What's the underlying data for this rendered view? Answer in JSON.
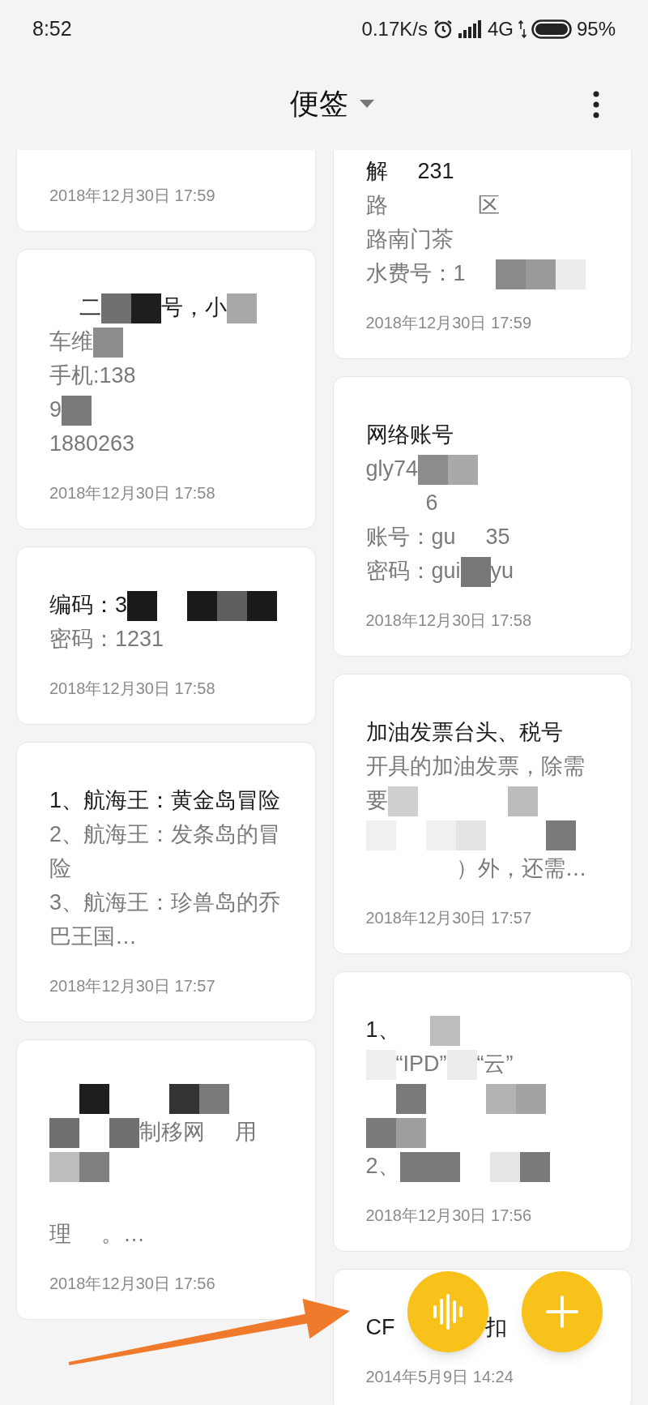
{
  "status_bar": {
    "time": "8:52",
    "speed": "0.17K/s",
    "network": "4G",
    "battery": "95%"
  },
  "header": {
    "title": "便签"
  },
  "columns": [
    {
      "notes": [
        {
          "lines": [
            [
              {
                "kind": "blank"
              }
            ]
          ],
          "date": "2018年12月30日 17:59"
        },
        {
          "lines": [
            [
              {
                "kind": "blank"
              },
              {
                "kind": "text",
                "text": "二"
              },
              {
                "kind": "pixel",
                "color": "#707070"
              },
              {
                "kind": "pixel",
                "color": "#1e1e1e"
              },
              {
                "kind": "text",
                "text": "号，小"
              },
              {
                "kind": "pixel",
                "color": "#a8a8a8"
              }
            ],
            [
              {
                "kind": "text",
                "text": "车维"
              },
              {
                "kind": "pixel",
                "color": "#8c8c8c"
              }
            ],
            [
              {
                "kind": "text",
                "text": "手机:138"
              }
            ],
            [
              {
                "kind": "text",
                "text": "9"
              },
              {
                "kind": "pixel",
                "color": "#7a7a7a"
              }
            ],
            [
              {
                "kind": "text",
                "text": "1880263"
              }
            ]
          ],
          "date": "2018年12月30日 17:58"
        },
        {
          "lines": [
            [
              {
                "kind": "text",
                "text": "编码：3"
              },
              {
                "kind": "pixel",
                "color": "#1a1a1a"
              },
              {
                "kind": "blank"
              },
              {
                "kind": "pixel",
                "color": "#1a1a1a"
              },
              {
                "kind": "pixel",
                "color": "#5e5e5e"
              },
              {
                "kind": "pixel",
                "color": "#1a1a1a"
              }
            ],
            [
              {
                "kind": "text",
                "text": "密码：1231"
              }
            ]
          ],
          "date": "2018年12月30日 17:58"
        },
        {
          "lines": [
            [
              {
                "kind": "text",
                "text": "1、航海王：黄金岛冒险"
              }
            ],
            [
              {
                "kind": "text",
                "text": "2、航海王：发条岛的冒险"
              }
            ],
            [
              {
                "kind": "text",
                "text": "3、航海王：珍兽岛的乔巴王国…"
              }
            ]
          ],
          "date": "2018年12月30日 17:57"
        },
        {
          "lines": [
            [
              {
                "kind": "blank"
              },
              {
                "kind": "pixel",
                "color": "#1e1e1e"
              },
              {
                "kind": "blank"
              },
              {
                "kind": "blank"
              },
              {
                "kind": "pixel",
                "color": "#333333"
              },
              {
                "kind": "pixel",
                "color": "#7a7a7a"
              }
            ],
            [
              {
                "kind": "pixel",
                "color": "#707070"
              },
              {
                "kind": "blank"
              },
              {
                "kind": "pixel",
                "color": "#707070"
              },
              {
                "kind": "text",
                "text": "制移网"
              },
              {
                "kind": "blank"
              },
              {
                "kind": "text",
                "text": "用"
              }
            ],
            [
              {
                "kind": "pixel",
                "color": "#bdbdbd"
              },
              {
                "kind": "pixel",
                "color": "#808080"
              }
            ],
            [
              {
                "kind": "blank"
              }
            ],
            [
              {
                "kind": "text",
                "text": "理"
              },
              {
                "kind": "blank"
              },
              {
                "kind": "text",
                "text": "。…"
              }
            ]
          ],
          "date": "2018年12月30日 17:56"
        }
      ]
    },
    {
      "notes": [
        {
          "lines": [
            [
              {
                "kind": "text",
                "text": "解"
              },
              {
                "kind": "blank"
              },
              {
                "kind": "text",
                "text": "231"
              }
            ],
            [
              {
                "kind": "text",
                "text": "路"
              },
              {
                "kind": "blank"
              },
              {
                "kind": "blank"
              },
              {
                "kind": "blank"
              },
              {
                "kind": "text",
                "text": "区"
              }
            ],
            [
              {
                "kind": "text",
                "text": "路南门茶"
              }
            ],
            [
              {
                "kind": "text",
                "text": "水费号：1"
              },
              {
                "kind": "blank"
              },
              {
                "kind": "pixel",
                "color": "#8a8a8a"
              },
              {
                "kind": "pixel",
                "color": "#9a9a9a"
              },
              {
                "kind": "pixel",
                "color": "#ececec"
              }
            ]
          ],
          "date": "2018年12月30日 17:59"
        },
        {
          "lines": [
            [
              {
                "kind": "text",
                "text": "网络账号"
              }
            ],
            [
              {
                "kind": "text",
                "text": "gly74"
              },
              {
                "kind": "pixel",
                "color": "#8c8c8c"
              },
              {
                "kind": "pixel",
                "color": "#a9a9a9"
              }
            ],
            [
              {
                "kind": "blank"
              },
              {
                "kind": "blank"
              },
              {
                "kind": "text",
                "text": "6"
              }
            ],
            [
              {
                "kind": "text",
                "text": "账号：gu"
              },
              {
                "kind": "blank"
              },
              {
                "kind": "text",
                "text": "35"
              }
            ],
            [
              {
                "kind": "text",
                "text": "密码：gui"
              },
              {
                "kind": "pixel",
                "color": "#777777"
              },
              {
                "kind": "text",
                "text": "yu"
              }
            ]
          ],
          "date": "2018年12月30日 17:58"
        },
        {
          "lines": [
            [
              {
                "kind": "text",
                "text": "加油发票台头、税号"
              }
            ],
            [
              {
                "kind": "text",
                "text": "开具的加油发票，除需"
              }
            ],
            [
              {
                "kind": "text",
                "text": "要"
              },
              {
                "kind": "pixel",
                "color": "#cfcfcf"
              },
              {
                "kind": "blank"
              },
              {
                "kind": "blank"
              },
              {
                "kind": "blank"
              },
              {
                "kind": "pixel",
                "color": "#bcbcbc"
              }
            ],
            [
              {
                "kind": "pixel",
                "color": "#f0f0f0"
              },
              {
                "kind": "blank"
              },
              {
                "kind": "pixel",
                "color": "#f0f0f0"
              },
              {
                "kind": "pixel",
                "color": "#e4e4e4"
              },
              {
                "kind": "blank"
              },
              {
                "kind": "blank"
              },
              {
                "kind": "pixel",
                "color": "#7a7a7a"
              }
            ],
            [
              {
                "kind": "blank"
              },
              {
                "kind": "blank"
              },
              {
                "kind": "blank"
              },
              {
                "kind": "text",
                "text": "）外，还需…"
              }
            ]
          ],
          "date": "2018年12月30日 17:57"
        },
        {
          "lines": [
            [
              {
                "kind": "text",
                "text": "1、"
              },
              {
                "kind": "blank"
              },
              {
                "kind": "pixel",
                "color": "#bdbdbd"
              }
            ],
            [
              {
                "kind": "pixel",
                "color": "#eeeeee"
              },
              {
                "kind": "text",
                "text": "“IPD”"
              },
              {
                "kind": "pixel",
                "color": "#ececec"
              },
              {
                "kind": "text",
                "text": "“云”"
              }
            ],
            [
              {
                "kind": "blank"
              },
              {
                "kind": "pixel",
                "color": "#7a7a7a"
              },
              {
                "kind": "blank"
              },
              {
                "kind": "blank"
              },
              {
                "kind": "pixel",
                "color": "#b3b3b3"
              },
              {
                "kind": "pixel",
                "color": "#a3a3a3"
              }
            ],
            [
              {
                "kind": "pixel",
                "color": "#7a7a7a"
              },
              {
                "kind": "pixel",
                "color": "#9e9e9e"
              }
            ],
            [
              {
                "kind": "text",
                "text": "2、"
              },
              {
                "kind": "pixel",
                "color": "#7a7a7a"
              },
              {
                "kind": "pixel",
                "color": "#7a7a7a"
              },
              {
                "kind": "blank"
              },
              {
                "kind": "pixel",
                "color": "#e6e6e6"
              },
              {
                "kind": "pixel",
                "color": "#7a7a7a"
              }
            ]
          ],
          "date": "2018年12月30日 17:56"
        },
        {
          "lines": [
            [
              {
                "kind": "text",
                "text": "CF"
              },
              {
                "kind": "blank"
              },
              {
                "kind": "blank"
              },
              {
                "kind": "blank"
              },
              {
                "kind": "text",
                "text": "扣"
              }
            ]
          ],
          "date": "2014年5月9日 14:24"
        }
      ]
    }
  ],
  "fabs": [
    {
      "kind": "voice"
    },
    {
      "kind": "add"
    }
  ]
}
